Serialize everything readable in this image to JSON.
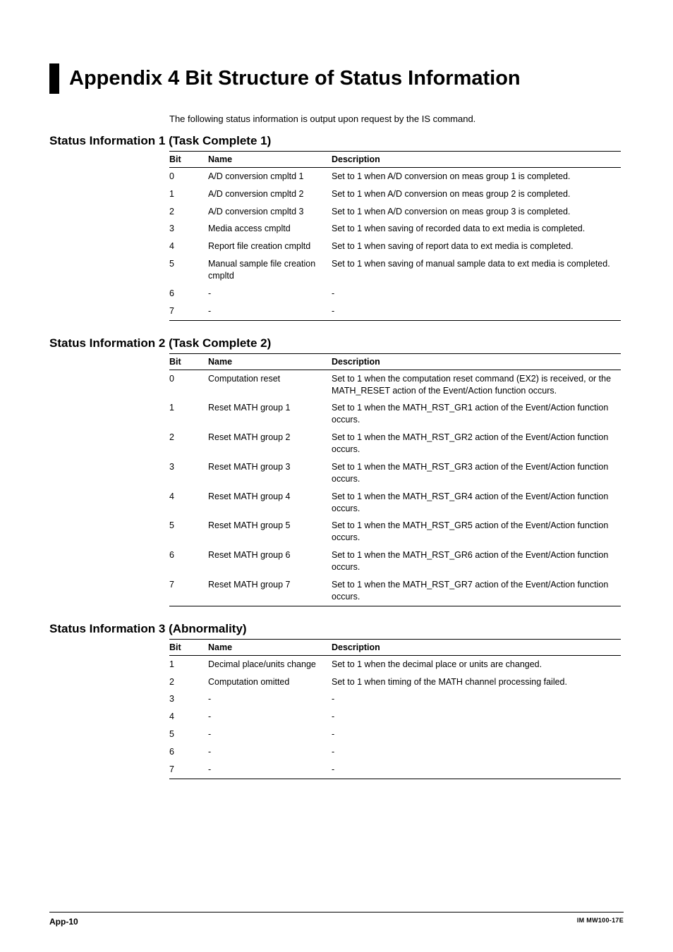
{
  "title": "Appendix 4   Bit Structure of Status Information",
  "intro": "The following status information is output upon request by the IS command.",
  "columns": {
    "bit": "Bit",
    "name": "Name",
    "desc": "Description"
  },
  "sections": [
    {
      "heading": "Status Information 1 (Task Complete 1)",
      "rows": [
        {
          "bit": "0",
          "name": "A/D conversion cmpltd 1",
          "desc": "Set to 1 when A/D conversion on meas group 1 is completed."
        },
        {
          "bit": "1",
          "name": "A/D conversion cmpltd 2",
          "desc": "Set to 1 when A/D conversion on meas group 2 is completed."
        },
        {
          "bit": "2",
          "name": "A/D conversion cmpltd 3",
          "desc": "Set to 1 when A/D conversion on meas group 3 is completed."
        },
        {
          "bit": "3",
          "name": "Media access cmpltd",
          "desc": "Set to 1 when saving of recorded data to ext media is completed."
        },
        {
          "bit": "4",
          "name": "Report file creation cmpltd",
          "desc": "Set to 1 when saving of report data to ext media is completed."
        },
        {
          "bit": "5",
          "name": "Manual sample file creation cmpltd",
          "desc": "Set to 1 when saving of manual sample data to ext media is completed."
        },
        {
          "bit": "6",
          "name": "-",
          "desc": "-"
        },
        {
          "bit": "7",
          "name": "-",
          "desc": "-"
        }
      ]
    },
    {
      "heading": "Status Information 2 (Task Complete 2)",
      "rows": [
        {
          "bit": "0",
          "name": "Computation reset",
          "desc": "Set to 1 when the computation reset command (EX2) is received, or the MATH_RESET action of the Event/Action function occurs."
        },
        {
          "bit": "1",
          "name": "Reset MATH group 1",
          "desc": "Set to 1 when the MATH_RST_GR1 action of the Event/Action function occurs."
        },
        {
          "bit": "2",
          "name": "Reset MATH group 2",
          "desc": "Set to 1 when the MATH_RST_GR2 action of the Event/Action function occurs."
        },
        {
          "bit": "3",
          "name": "Reset MATH group 3",
          "desc": "Set to 1 when the MATH_RST_GR3 action of the Event/Action function occurs."
        },
        {
          "bit": "4",
          "name": "Reset MATH group 4",
          "desc": "Set to 1 when the MATH_RST_GR4 action of the Event/Action function occurs."
        },
        {
          "bit": "5",
          "name": "Reset MATH group 5",
          "desc": "Set to 1 when the MATH_RST_GR5 action of the Event/Action function occurs."
        },
        {
          "bit": "6",
          "name": "Reset MATH group 6",
          "desc": "Set to 1 when the MATH_RST_GR6 action of the Event/Action function occurs."
        },
        {
          "bit": "7",
          "name": "Reset MATH group 7",
          "desc": "Set to 1 when the MATH_RST_GR7 action of the Event/Action function occurs."
        }
      ]
    },
    {
      "heading": "Status Information 3 (Abnormality)",
      "rows": [
        {
          "bit": "1",
          "name": "Decimal place/units change",
          "desc": "Set to 1 when the decimal place or units are changed."
        },
        {
          "bit": "2",
          "name": "Computation omitted",
          "desc": "Set to 1 when timing of the MATH channel processing failed."
        },
        {
          "bit": "3",
          "name": "-",
          "desc": "-"
        },
        {
          "bit": "4",
          "name": "-",
          "desc": "-"
        },
        {
          "bit": "5",
          "name": "-",
          "desc": "-"
        },
        {
          "bit": "6",
          "name": "-",
          "desc": "-"
        },
        {
          "bit": "7",
          "name": "-",
          "desc": "-"
        }
      ]
    }
  ],
  "footer": {
    "page": "App-10",
    "doc": "IM MW100-17E"
  }
}
